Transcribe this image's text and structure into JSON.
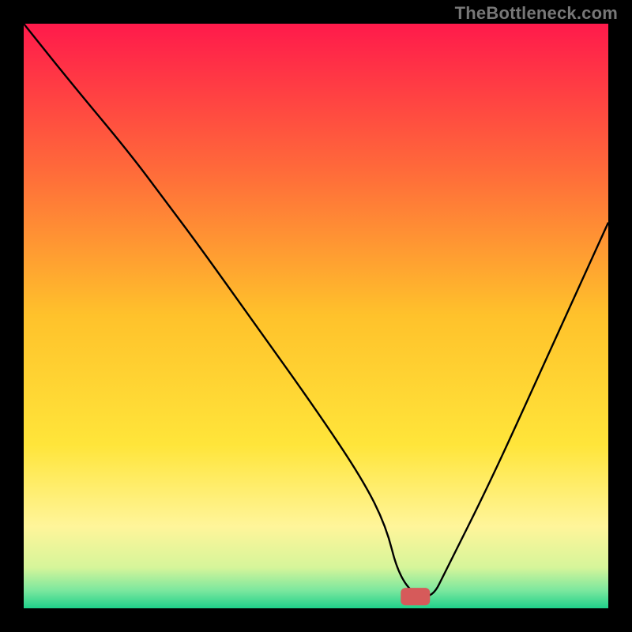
{
  "watermark": "TheBottleneck.com",
  "chart_data": {
    "type": "line",
    "title": "",
    "xlabel": "",
    "ylabel": "",
    "xlim": [
      0,
      100
    ],
    "ylim": [
      0,
      100
    ],
    "grid": false,
    "background_gradient_stops": [
      {
        "pos": 0.0,
        "color": "#ff1a4b"
      },
      {
        "pos": 0.25,
        "color": "#ff6a3a"
      },
      {
        "pos": 0.5,
        "color": "#ffc22b"
      },
      {
        "pos": 0.72,
        "color": "#ffe53a"
      },
      {
        "pos": 0.86,
        "color": "#fff59a"
      },
      {
        "pos": 0.93,
        "color": "#d6f59a"
      },
      {
        "pos": 0.97,
        "color": "#7ae79e"
      },
      {
        "pos": 1.0,
        "color": "#1fd18a"
      }
    ],
    "marker": {
      "x": 67,
      "y": 2,
      "color": "#d65a5a",
      "width": 5,
      "height": 3
    },
    "series": [
      {
        "name": "curve",
        "x": [
          0,
          8,
          18,
          24,
          30,
          40,
          50,
          58,
          62,
          64,
          67,
          70,
          72,
          80,
          90,
          100
        ],
        "y": [
          100,
          90,
          78,
          70,
          62,
          48,
          34,
          22,
          14,
          6,
          2,
          2,
          6,
          22,
          44,
          66
        ]
      }
    ]
  }
}
